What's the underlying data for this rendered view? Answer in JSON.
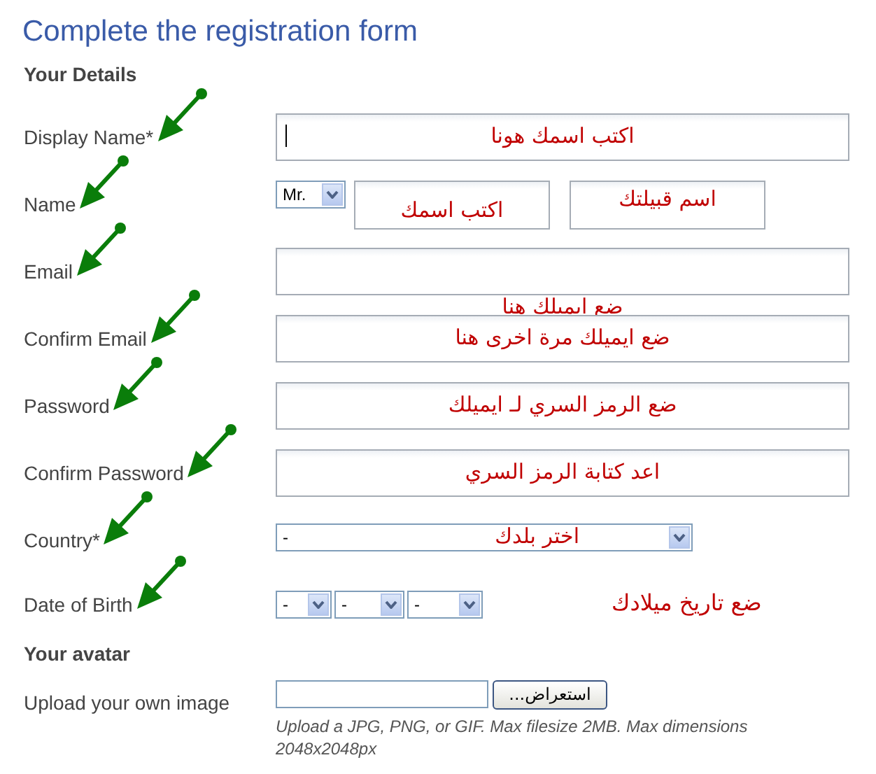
{
  "title": "Complete the registration form",
  "sections": [
    {
      "heading": "Your Details",
      "rows": [
        {
          "kind": "text",
          "label": "Display Name*",
          "focused": true,
          "arrow": true,
          "annotation": "اكتب اسمك هونا",
          "annotation_below": false
        },
        {
          "kind": "name",
          "label": "Name",
          "arrow": true,
          "title_value": "Mr.",
          "annotations": [
            "اكتب اسمك",
            "اسم قبيلتك"
          ]
        },
        {
          "kind": "text",
          "label": "Email",
          "focused": false,
          "arrow": true,
          "annotation": "ضع ايميلك هنا",
          "annotation_below": true
        },
        {
          "kind": "text",
          "label": "Confirm Email",
          "focused": false,
          "arrow": true,
          "annotation": "ضع ايميلك مرة اخرى هنا",
          "annotation_below": false
        },
        {
          "kind": "text",
          "label": "Password",
          "focused": false,
          "arrow": true,
          "annotation": "ضع الرمز السري لـ ايميلك",
          "annotation_below": false
        },
        {
          "kind": "text",
          "label": "Confirm Password",
          "focused": false,
          "arrow": true,
          "annotation": "اعد كتابة الرمز السري",
          "annotation_below": false
        },
        {
          "kind": "select",
          "label": "Country*",
          "arrow": true,
          "value": "-",
          "annotation": "اختر  بلدك"
        },
        {
          "kind": "date",
          "label": "Date of Birth",
          "arrow": true,
          "day": "-",
          "month": "-",
          "year": "-",
          "annotation": "ضع تاريخ ميلادك"
        }
      ]
    },
    {
      "heading": "Your avatar",
      "rows": [
        {
          "kind": "file",
          "label": "Upload your own image",
          "arrow": false,
          "button": "استعراض...",
          "hint": "Upload a JPG, PNG, or GIF. Max filesize 2MB. Max dimensions 2048x2048px"
        }
      ]
    }
  ]
}
